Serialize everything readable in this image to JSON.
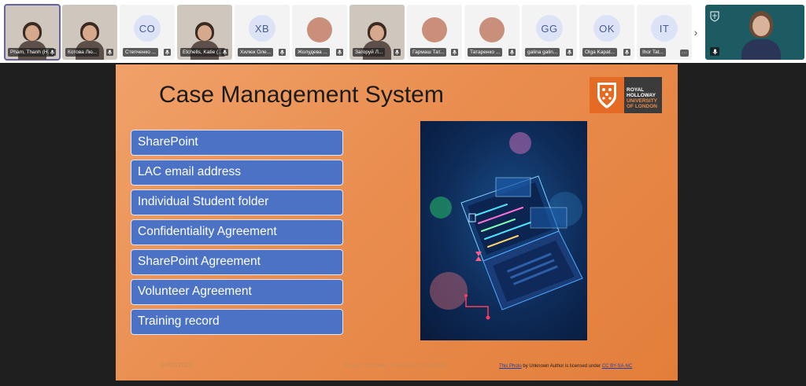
{
  "participants": [
    {
      "name": "Pham, Thanh (H...",
      "kind": "video",
      "active": true
    },
    {
      "name": "Котова Лю...",
      "kind": "video"
    },
    {
      "name": "Степченко ...",
      "kind": "initials",
      "initials": "CO"
    },
    {
      "name": "Etchells, Katie (...",
      "kind": "video"
    },
    {
      "name": "Хилюк Оле...",
      "kind": "initials",
      "initials": "XB"
    },
    {
      "name": "Жолудева ...",
      "kind": "photo"
    },
    {
      "name": "Загоруй Л...",
      "kind": "video"
    },
    {
      "name": "Гармаш Тат...",
      "kind": "photo"
    },
    {
      "name": "Татаренко ...",
      "kind": "photo"
    },
    {
      "name": "galina galin...",
      "kind": "initials",
      "initials": "GG"
    },
    {
      "name": "Olga Kapat...",
      "kind": "initials",
      "initials": "OK"
    },
    {
      "name": "Ihor Tat...",
      "kind": "initials",
      "initials": "IT",
      "more": "···"
    }
  ],
  "strip_next_icon": "chevron-right-icon",
  "strip_next_glyph": "›",
  "slide": {
    "title": "Case Management System",
    "items": [
      "SharePoint",
      "LAC email address",
      "Individual Student folder",
      "Confidentiality Agreement",
      "SharePoint Agreement",
      "Volunteer Agreement",
      "Training record"
    ],
    "logo": {
      "line1": "ROYAL",
      "line2": "HOLLOWAY",
      "line3": "UNIVERSITY",
      "line4": "OF LONDON"
    },
    "footer_date": "00/00/2023",
    "footer_center": "Royal Holloway, University of London",
    "credit": {
      "link1": "This Photo",
      "middle": " by Unknown Author is licensed under ",
      "link2": "CC BY-SA-NC"
    }
  },
  "colors": {
    "slide_orange": "#e98d4f",
    "item_blue": "#4b72c4",
    "presenter_bg": "#1c5b62",
    "logo_orange": "#e56a23"
  }
}
